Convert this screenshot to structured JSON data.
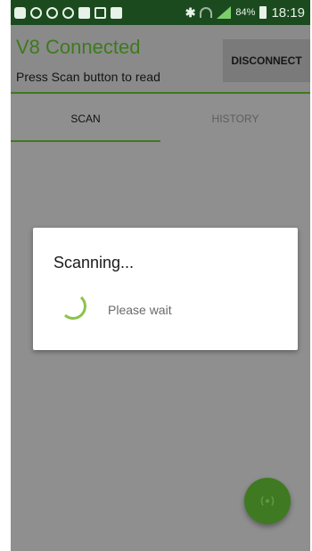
{
  "status_bar": {
    "time": "18:19",
    "battery": "84%",
    "left_icons": [
      "message-icon",
      "minus-circle-icon",
      "whatsapp-icon",
      "chat-check-icon",
      "mail-icon",
      "image-icon",
      "photo-icon"
    ],
    "right_icons": [
      "bluetooth-icon",
      "wifi-icon",
      "signal-icon",
      "battery-icon"
    ],
    "colors": {
      "bar": "#1b4a1f"
    }
  },
  "header": {
    "title": "V8 Connected",
    "subtitle": "Press Scan button to read",
    "disconnect_label": "DISCONNECT",
    "accent_color": "#3d7a1f"
  },
  "tabs": [
    {
      "label": "SCAN",
      "active": true
    },
    {
      "label": "HISTORY",
      "active": false
    }
  ],
  "dialog": {
    "title": "Scanning...",
    "message": "Please wait",
    "spinner_color": "#8bc34a"
  },
  "fab": {
    "icon": "nfc-scan-icon",
    "color": "#3f7a22"
  }
}
